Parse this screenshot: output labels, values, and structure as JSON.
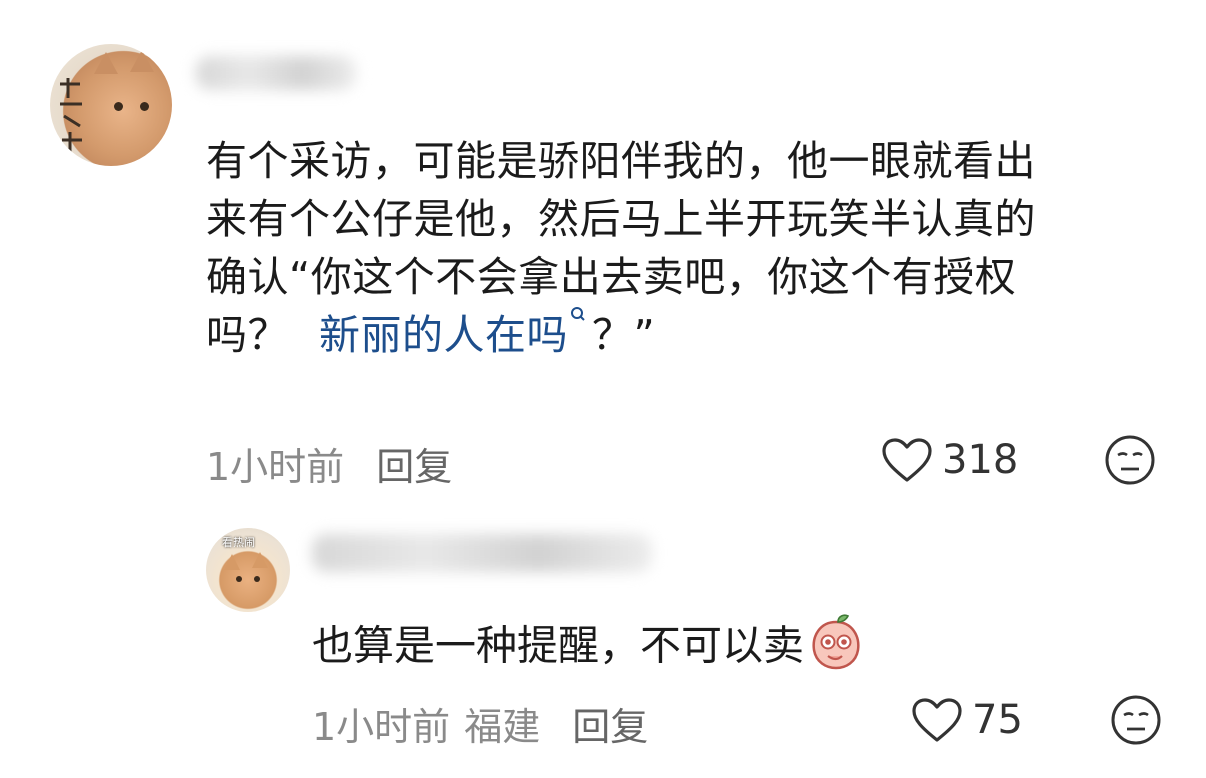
{
  "comment": {
    "lines": [
      "有个采访，可能是骄阳伴我的，他一眼就看出",
      "来有个公仔是他，然后马上半开玩笑半认真的",
      "确认“你这个不会拿出去卖吧，你这个有授权",
      "吗？"
    ],
    "link_text": "新丽的人在吗",
    "tail_text": "？”",
    "time": "1小时前",
    "reply_label": "回复",
    "likes": "318"
  },
  "reply": {
    "avatar_badge": "看热闹",
    "text": "也算是一种提醒，不可以卖",
    "time": "1小时前",
    "region": "福建",
    "reply_label": "回复",
    "likes": "75"
  },
  "icons": {
    "like": "heart-outline-icon",
    "dislike": "meh-face-icon",
    "search": "search-icon",
    "emoji": "peach-face-emoji-icon"
  },
  "colors": {
    "link": "#1d4e8c",
    "meta_text": "#8a8a8a",
    "body_text": "#1b1b1b"
  }
}
